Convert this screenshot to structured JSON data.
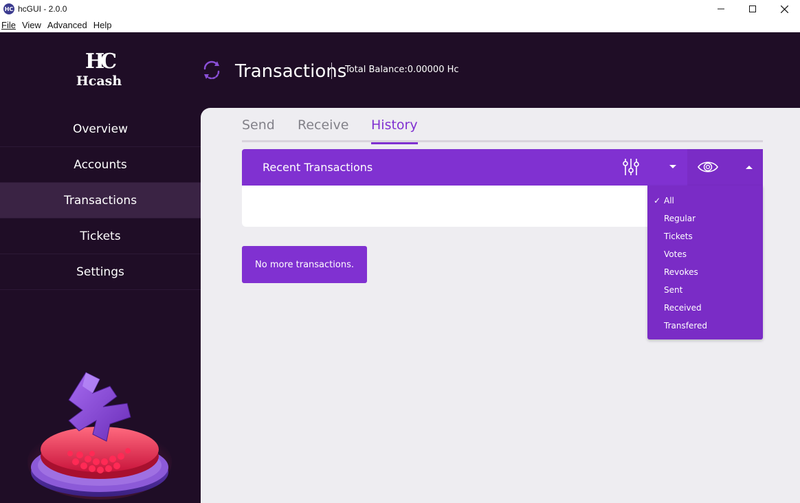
{
  "window": {
    "title": "hcGUI - 2.0.0",
    "app_icon": "hc-logo-icon",
    "controls": [
      "minimize-icon",
      "maximize-icon",
      "close-icon"
    ]
  },
  "menubar": {
    "items": [
      "File",
      "View",
      "Advanced",
      "Help"
    ]
  },
  "sidebar": {
    "logo_mark": "HC",
    "logo_text": "Hcash",
    "items": [
      {
        "label": "Overview",
        "active": false
      },
      {
        "label": "Accounts",
        "active": false
      },
      {
        "label": "Transactions",
        "active": true
      },
      {
        "label": "Tickets",
        "active": false
      },
      {
        "label": "Settings",
        "active": false
      }
    ]
  },
  "header": {
    "icon": "refresh-icon",
    "title": "Transactions",
    "balance": "Total Balance:0.00000 Hc"
  },
  "tabs": [
    {
      "label": "Send",
      "active": false
    },
    {
      "label": "Receive",
      "active": false
    },
    {
      "label": "History",
      "active": true
    }
  ],
  "panel": {
    "title": "Recent Transactions",
    "filter_icon": "sliders-icon",
    "view_icon": "eye-icon"
  },
  "dropdown": {
    "items": [
      {
        "label": "All",
        "checked": true
      },
      {
        "label": "Regular",
        "checked": false
      },
      {
        "label": "Tickets",
        "checked": false
      },
      {
        "label": "Votes",
        "checked": false
      },
      {
        "label": "Revokes",
        "checked": false
      },
      {
        "label": "Sent",
        "checked": false
      },
      {
        "label": "Received",
        "checked": false
      },
      {
        "label": "Transfered",
        "checked": false
      }
    ],
    "check_mark": "✓"
  },
  "status": {
    "no_more": "No more transactions."
  },
  "colors": {
    "accent": "#8031d1",
    "sidebar_bg": "#1f0d26",
    "content_bg": "#eeedf1"
  }
}
